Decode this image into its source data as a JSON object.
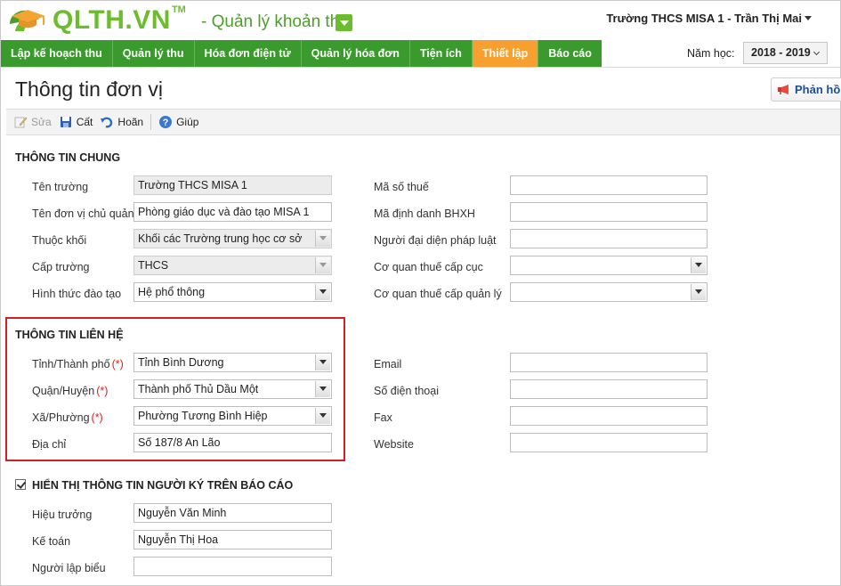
{
  "header": {
    "logo_text": "QLTH.VN",
    "logo_tm": "TM",
    "module_title": "- Quản lý khoản thu",
    "user_info": "Trường THCS MISA 1 - Trần Thị Mai"
  },
  "nav": {
    "tabs": [
      {
        "label": "Lập kế hoạch thu",
        "active": false
      },
      {
        "label": "Quản lý thu",
        "active": false
      },
      {
        "label": "Hóa đơn điện tử",
        "active": false
      },
      {
        "label": "Quản lý hóa đơn",
        "active": false
      },
      {
        "label": "Tiện ích",
        "active": false
      },
      {
        "label": "Thiết lập",
        "active": true
      },
      {
        "label": "Báo cáo",
        "active": false
      }
    ],
    "year_label": "Năm học:",
    "year_value": "2018 - 2019"
  },
  "page": {
    "title": "Thông tin đơn vị",
    "feedback_label": "Phản hồi"
  },
  "toolbar": {
    "edit_label": "Sửa",
    "save_label": "Cất",
    "undo_label": "Hoãn",
    "help_label": "Giúp"
  },
  "general": {
    "title": "THÔNG TIN CHUNG",
    "school_name_label": "Tên trường",
    "school_name_value": "Trường THCS MISA 1",
    "parent_unit_label": "Tên đơn vị chủ quản",
    "parent_unit_value": "Phòng giáo dục và đào tạo MISA 1",
    "block_label": "Thuộc khối",
    "block_value": "Khối các Trường trung học cơ sở",
    "level_label": "Cấp trường",
    "level_value": "THCS",
    "training_label": "Hình thức đào tạo",
    "training_value": "Hệ phổ thông",
    "tax_code_label": "Mã số thuế",
    "tax_code_value": "",
    "bhxh_label": "Mã định danh BHXH",
    "bhxh_value": "",
    "legal_rep_label": "Người đại diện pháp luật",
    "legal_rep_value": "",
    "tax_dept_label": "Cơ quan thuế cấp cục",
    "tax_dept_value": "",
    "tax_manage_label": "Cơ quan thuế cấp quản lý",
    "tax_manage_value": ""
  },
  "contact": {
    "title": "THÔNG TIN LIÊN HỆ",
    "required_mark": "(*)",
    "province_label": "Tỉnh/Thành phố",
    "province_value": "Tỉnh Bình Dương",
    "district_label": "Quận/Huyện",
    "district_value": "Thành phố Thủ Dầu Một",
    "ward_label": "Xã/Phường",
    "ward_value": "Phường Tương Bình Hiệp",
    "address_label": "Địa chỉ",
    "address_value": "Số 187/8 An Lão",
    "email_label": "Email",
    "email_value": "",
    "phone_label": "Số điện thoại",
    "phone_value": "",
    "fax_label": "Fax",
    "fax_value": "",
    "website_label": "Website",
    "website_value": ""
  },
  "signer": {
    "checkbox_checked": true,
    "title": "HIỂN THỊ THÔNG TIN NGƯỜI KÝ TRÊN BÁO CÁO",
    "principal_label": "Hiệu trưởng",
    "principal_value": "Nguyễn Văn Minh",
    "accountant_label": "Kế toán",
    "accountant_value": "Nguyễn Thị Hoa",
    "preparer_label": "Người lập biểu",
    "preparer_value": ""
  },
  "colors": {
    "brand_green": "#6cbd2e",
    "nav_green": "#3b9a2d",
    "nav_active": "#f7a030",
    "highlight_red": "#d21f1f"
  },
  "icons": [
    "graduation-cap-logo-icon",
    "chevron-down-icon",
    "megaphone-icon",
    "edit-icon",
    "save-icon",
    "undo-icon",
    "help-icon",
    "checkbox-icon"
  ]
}
